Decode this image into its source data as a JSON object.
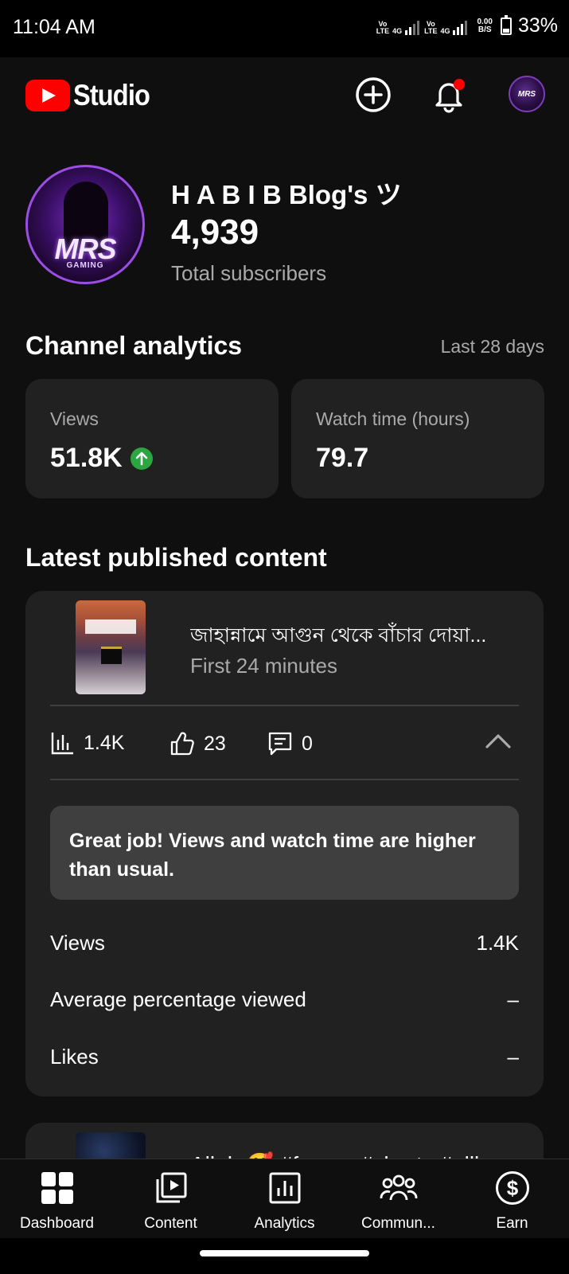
{
  "status_bar": {
    "time": "11:04 AM",
    "sim1_tag_top": "Vo",
    "sim1_tag_bottom": "LTE",
    "sim1_network": "4G",
    "sim2_tag_top": "Vo",
    "sim2_tag_bottom": "LTE",
    "sim2_network": "4G",
    "net_speed_value": "0.00",
    "net_speed_unit": "B/S",
    "battery": "33%",
    "battery_level": 0.33
  },
  "header": {
    "app_name": "Studio",
    "create_icon": "plus-circle-icon",
    "notifications_icon": "bell-icon",
    "notification_dot_color": "#ff0000",
    "account_avatar_text": "MRS"
  },
  "channel": {
    "name": "H A B I B Blog's ツ",
    "subscribers": "4,939",
    "subscribers_label": "Total subscribers",
    "avatar_text": "MRS",
    "avatar_subtext": "GAMING"
  },
  "analytics": {
    "title": "Channel analytics",
    "period": "Last 28 days",
    "cards": [
      {
        "label": "Views",
        "value": "51.8K",
        "trend": "up"
      },
      {
        "label": "Watch time (hours)",
        "value": "79.7"
      }
    ]
  },
  "latest": {
    "title": "Latest published content",
    "video": {
      "title": "জাহান্নামে আগুন থেকে বাঁচার দোয়া...",
      "subtitle": "First 24 minutes",
      "views": "1.4K",
      "likes": "23",
      "comments": "0",
      "callout": "Great job! Views and watch time are higher than usual.",
      "rows": [
        {
          "label": "Views",
          "value": "1.4K"
        },
        {
          "label": "Average percentage viewed",
          "value": "–"
        },
        {
          "label": "Likes",
          "value": "–"
        }
      ]
    },
    "next_video_title_partial": "Allah 🥰 #foryou #shorts #alll"
  },
  "bottom_nav": [
    {
      "label": "Dashboard",
      "icon": "dashboard-icon"
    },
    {
      "label": "Content",
      "icon": "content-icon"
    },
    {
      "label": "Analytics",
      "icon": "analytics-icon"
    },
    {
      "label": "Commun...",
      "icon": "community-icon"
    },
    {
      "label": "Earn",
      "icon": "earn-icon"
    }
  ],
  "colors": {
    "background": "#0f0f0f",
    "card": "#212121",
    "brand_red": "#ff0000",
    "trend_green": "#2ba640",
    "secondary_text": "#aaaaaa"
  }
}
